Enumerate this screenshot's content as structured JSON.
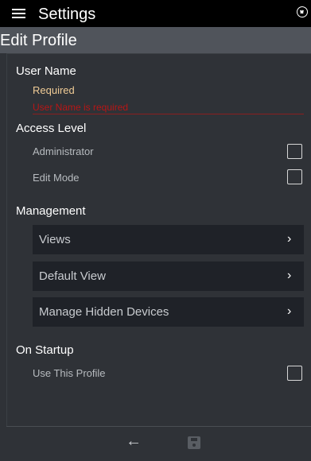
{
  "topbar": {
    "title": "Settings"
  },
  "header": {
    "title": "Edit Profile"
  },
  "user_name": {
    "label": "User Name",
    "placeholder": "Required",
    "error": "User Name is required"
  },
  "access_level": {
    "label": "Access Level",
    "items": [
      {
        "label": "Administrator"
      },
      {
        "label": "Edit Mode"
      }
    ]
  },
  "management": {
    "label": "Management",
    "items": [
      {
        "label": "Views"
      },
      {
        "label": "Default View"
      },
      {
        "label": "Manage Hidden Devices"
      }
    ]
  },
  "on_startup": {
    "label": "On Startup",
    "items": [
      {
        "label": "Use This Profile"
      }
    ]
  },
  "bottom": {
    "back_label": "←",
    "save_label": ""
  }
}
